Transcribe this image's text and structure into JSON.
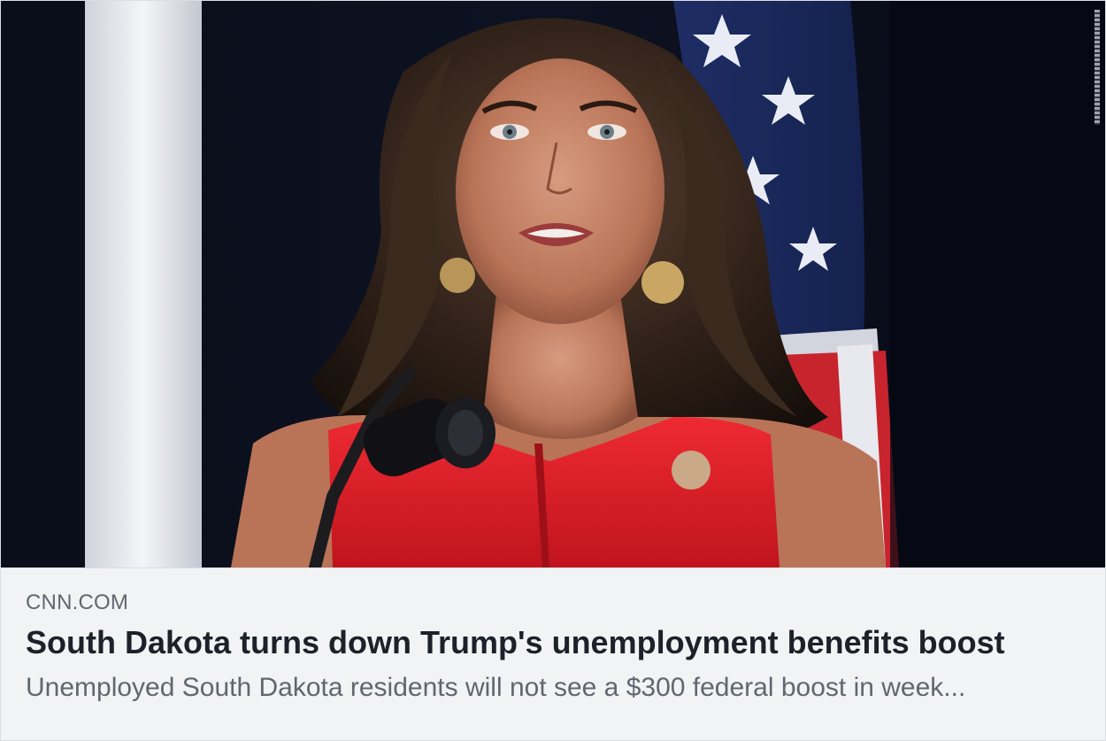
{
  "link_preview": {
    "domain": "CNN.COM",
    "headline": "South Dakota turns down Trump's unemployment benefits boost",
    "description": "Unemployed South Dakota residents will not see a $300 federal boost in week..."
  },
  "image": {
    "alt_subject": "speaker-at-microphone-with-flag"
  },
  "colors": {
    "card_background": "#f2f3f5",
    "domain_text": "#606770",
    "headline_text": "#1d2129",
    "description_text": "#606770",
    "dress_red": "#e0202a",
    "backdrop_navy": "#0b0f1c"
  }
}
